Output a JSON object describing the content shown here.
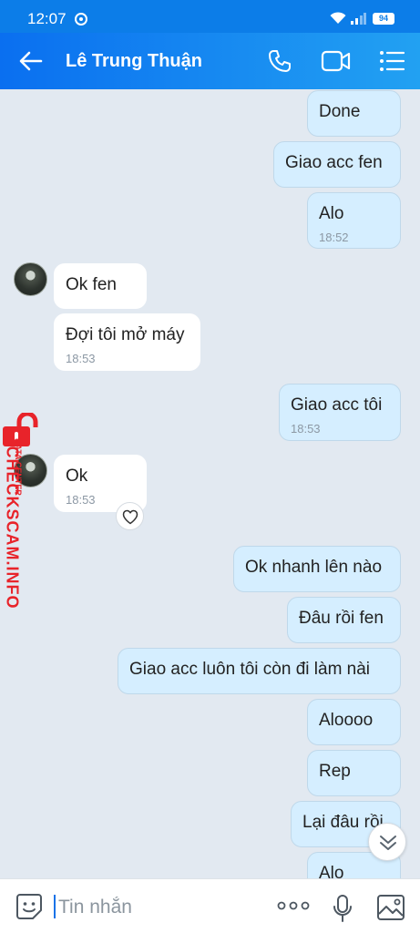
{
  "status_bar": {
    "time": "12:07",
    "battery": "94"
  },
  "header": {
    "contact_name": "Lê Trung Thuận"
  },
  "messages": [
    {
      "text": "Done",
      "time": ""
    },
    {
      "text": "Giao acc fen",
      "time": ""
    },
    {
      "text": "Alo",
      "time": "18:52"
    },
    {
      "text": "Ok fen",
      "time": ""
    },
    {
      "text": "Đợi tôi mở máy",
      "time": "18:53"
    },
    {
      "text": "Giao acc tôi",
      "time": "18:53"
    },
    {
      "text": "Ok",
      "time": "18:53"
    },
    {
      "text": "Ok nhanh lên nào",
      "time": ""
    },
    {
      "text": "Đâu rồi fen",
      "time": ""
    },
    {
      "text": "Giao acc luôn tôi còn đi làm nài",
      "time": ""
    },
    {
      "text": "Aloooo",
      "time": ""
    },
    {
      "text": "Rep",
      "time": ""
    },
    {
      "text": "Lại đâu rồi",
      "time": ""
    },
    {
      "text": "Alo",
      "time": ""
    }
  ],
  "watermark": {
    "brand": "CHECKSCAM.INFO",
    "subtitle": "DATA CENTER"
  },
  "composer": {
    "placeholder": "Tin nhắn"
  },
  "colors": {
    "header_start": "#0a6ff0",
    "header_end": "#22a1f2",
    "outgoing_bubble": "#d5eeff",
    "incoming_bubble": "#ffffff",
    "background": "#e2e9f1",
    "watermark": "#e8232a"
  },
  "icons": [
    "back-arrow-icon",
    "phone-icon",
    "video-call-icon",
    "list-menu-icon",
    "heart-icon",
    "chevron-double-down-icon",
    "sticker-icon",
    "more-icon",
    "microphone-icon",
    "image-icon",
    "lock-icon"
  ]
}
